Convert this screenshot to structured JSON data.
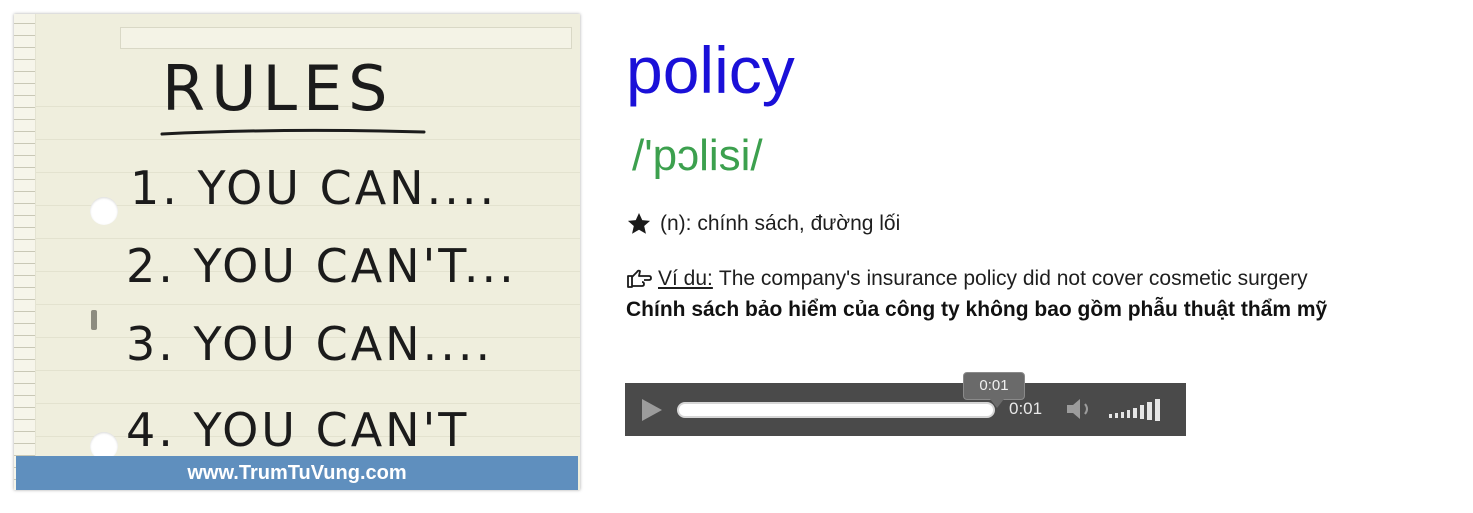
{
  "image": {
    "handwriting": {
      "title": "RULES",
      "lines": [
        "1. YOU CAN....",
        "2. YOU CAN'T...",
        "3. YOU CAN....",
        "4. YOU CAN'T"
      ]
    },
    "caption": "www.TrumTuVung.com"
  },
  "entry": {
    "word": "policy",
    "pronunciation": "/'pɔlisi/",
    "meaning_icon": "star-icon",
    "meaning": "(n): chính sách, đường lối",
    "example_icon": "pointing-hand-icon",
    "example_label": "Ví du:",
    "example_sentence": "The company's insurance policy did not cover cosmetic surgery",
    "translation": "Chính sách bảo hiểm của công ty không bao gồm phẫu thuật thẩm mỹ"
  },
  "player": {
    "play_icon": "play-icon",
    "current_time": "0:01",
    "hover_time": "0:01",
    "progress": 1.0,
    "volume_icon": "speaker-icon",
    "volume_level": 1.0,
    "colors": {
      "bar": "#4a4a4a",
      "track": "#ffffff",
      "controls": "#9c9c9c"
    }
  },
  "colors": {
    "word": "#1a10d8",
    "pronunciation": "#3ca04e",
    "caption_bg": "#5f8fbe"
  }
}
